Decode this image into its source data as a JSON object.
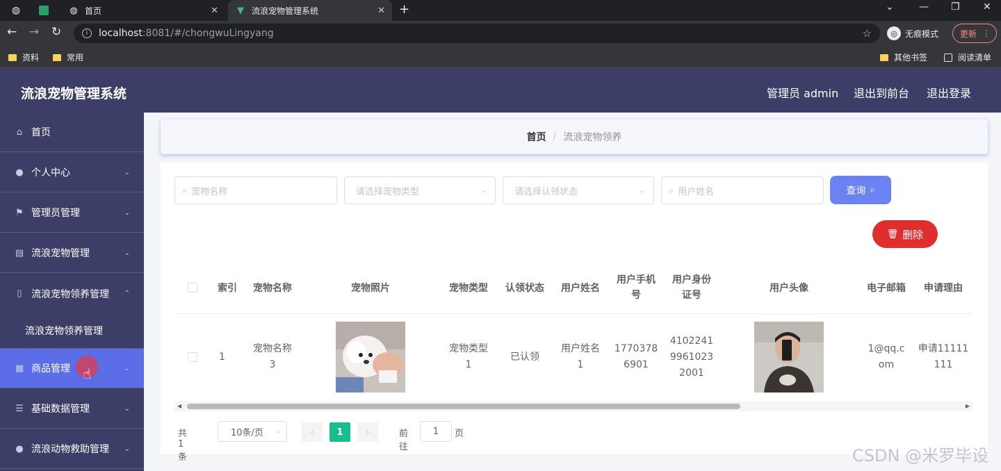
{
  "browser": {
    "tabs": [
      {
        "label": "首页"
      },
      {
        "label": "流浪宠物管理系统"
      }
    ],
    "url_host": "localhost",
    "url_path": ":8081/#/chongwuLingyang",
    "incognito_label": "无痕模式",
    "update_label": "更新",
    "bookmarks": [
      "资料",
      "常用"
    ],
    "bookmarks_right": [
      "其他书签",
      "阅读清单"
    ]
  },
  "header": {
    "title": "流浪宠物管理系统",
    "links": [
      "管理员 admin",
      "退出到前台",
      "退出登录"
    ]
  },
  "sidebar": {
    "items": [
      {
        "label": "首页",
        "icon": "home-icon"
      },
      {
        "label": "个人中心",
        "icon": "user-icon"
      },
      {
        "label": "管理员管理",
        "icon": "flag-icon"
      },
      {
        "label": "流浪宠物管理",
        "icon": "document-icon"
      },
      {
        "label": "流浪宠物领养管理",
        "icon": "phone-icon"
      },
      {
        "label": "流浪宠物领养管理"
      },
      {
        "label": "商品管理",
        "icon": "grid-icon"
      },
      {
        "label": "基础数据管理",
        "icon": "list-icon"
      },
      {
        "label": "流浪动物救助管理",
        "icon": "bulb-icon"
      }
    ]
  },
  "breadcrumb": {
    "home": "首页",
    "separator": "/",
    "current": "流浪宠物领养"
  },
  "filters": {
    "pet_name_placeholder": "宠物名称",
    "pet_type_placeholder": "请选择宠物类型",
    "status_placeholder": "请选择认领状态",
    "user_name_placeholder": "用户姓名",
    "query_label": "查询",
    "delete_label": "删除"
  },
  "table": {
    "headers": [
      "索引",
      "宠物名称",
      "宠物照片",
      "宠物类型",
      "认领状态",
      "用户姓名",
      "用户手机号",
      "用户身份证号",
      "用户头像",
      "电子邮箱",
      "申请理由"
    ],
    "rows": [
      {
        "index": "1",
        "pet_name": "宠物名称3",
        "pet_type": "宠物类型1",
        "status": "已认领",
        "user_name": "用户姓名1",
        "phone": "17703786901",
        "id_card": "410224199610232001",
        "email": "1@qq.com",
        "reason": "申请11111111"
      }
    ]
  },
  "pagination": {
    "total": "共 1 条",
    "page_size": "10条/页",
    "current_page": "1",
    "goto_label": "前往",
    "goto_value": "1",
    "page_suffix": "页"
  },
  "watermark": "CSDN @米罗毕设",
  "colors": {
    "header_bg": "#3c3e68",
    "active_menu": "#5b6ee8",
    "query_button": "#6b83f2",
    "delete_button": "#e02d2d",
    "page_active": "#19be8f"
  }
}
